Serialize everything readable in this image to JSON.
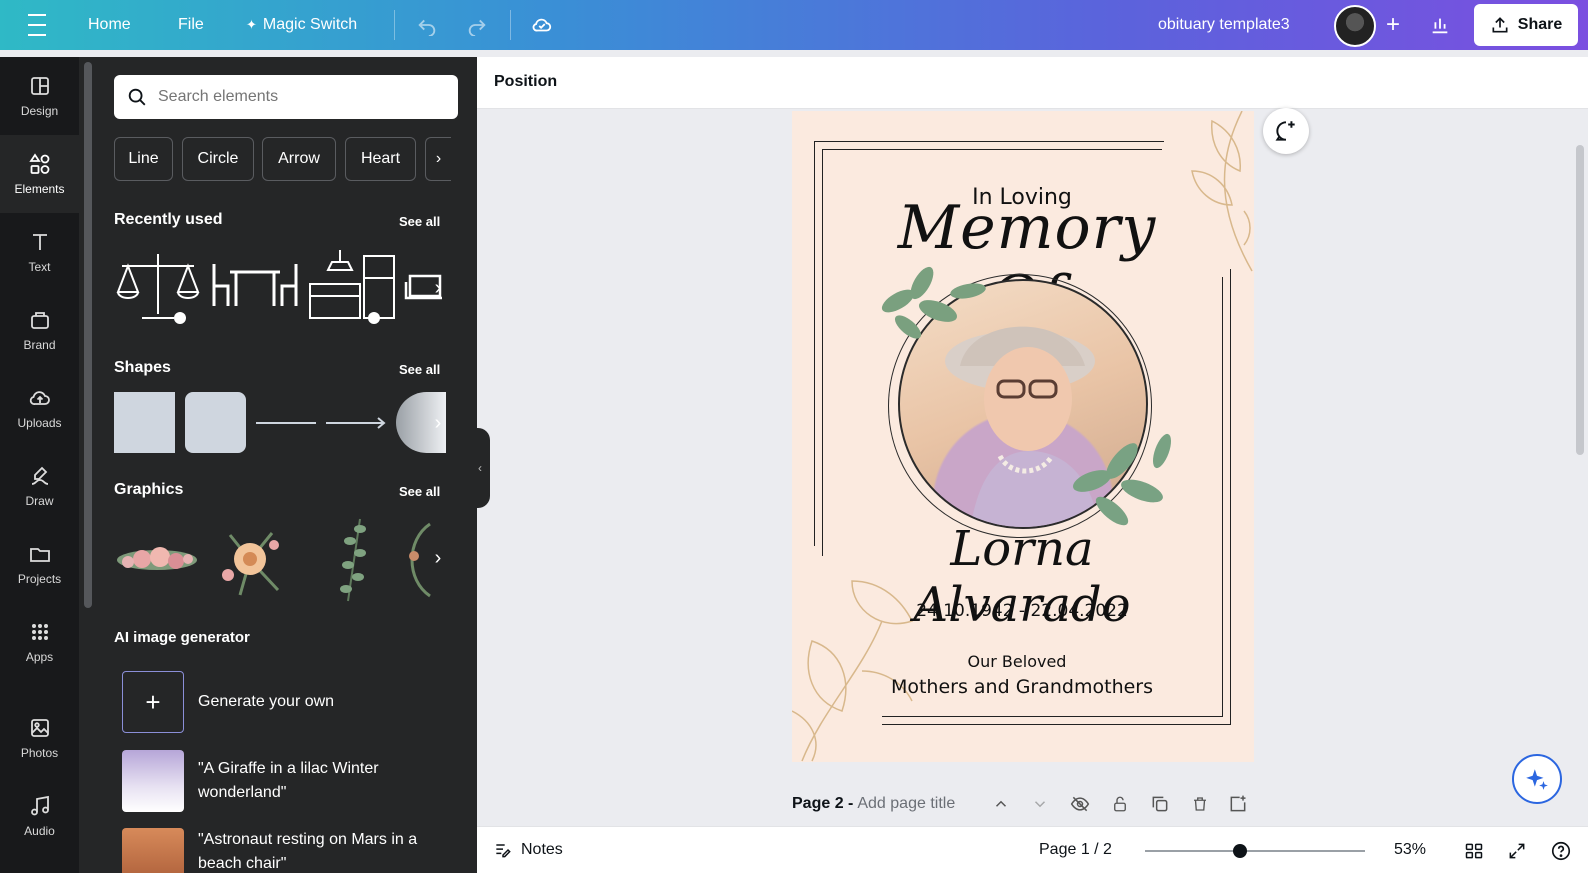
{
  "topbar": {
    "home": "Home",
    "file": "File",
    "magic_switch": "Magic Switch",
    "doc_title": "obituary template3",
    "share": "Share"
  },
  "rail": [
    {
      "label": "Design",
      "icon": "layout-icon"
    },
    {
      "label": "Elements",
      "icon": "shapes-icon"
    },
    {
      "label": "Text",
      "icon": "text-icon"
    },
    {
      "label": "Brand",
      "icon": "brand-icon"
    },
    {
      "label": "Uploads",
      "icon": "cloud-upload-icon"
    },
    {
      "label": "Draw",
      "icon": "pen-icon"
    },
    {
      "label": "Projects",
      "icon": "folder-icon"
    },
    {
      "label": "Apps",
      "icon": "grid-icon"
    },
    {
      "label": "Photos",
      "icon": "image-icon"
    },
    {
      "label": "Audio",
      "icon": "music-icon"
    }
  ],
  "panel": {
    "search_placeholder": "Search elements",
    "chips": [
      "Line",
      "Circle",
      "Arrow",
      "Heart"
    ],
    "recently_used": "Recently used",
    "shapes": "Shapes",
    "graphics": "Graphics",
    "see_all": "See all",
    "ai_title": "AI image generator",
    "generate": "Generate your own",
    "suggestions": [
      "\"A Giraffe in a lilac Winter wonderland\"",
      "\"Astronaut resting on Mars in a beach chair\""
    ]
  },
  "canvas": {
    "toolbar_label": "Position",
    "page": {
      "in_loving": "In Loving",
      "memory_of": "Memory Of",
      "name": "Lorna Alvarado",
      "dates": "24.10.1942 - 22.04.2022",
      "beloved": "Our Beloved",
      "relation": "Mothers and Grandmothers"
    },
    "page_label": "Page 2 -",
    "page_title_placeholder": "Add page title"
  },
  "bottombar": {
    "notes": "Notes",
    "page_count": "Page 1 / 2",
    "zoom": "53%"
  },
  "colors": {
    "page_bg": "#fbeadf",
    "panel_bg": "#252627",
    "rail_bg": "#18191b",
    "accent": "#7b4fe0"
  }
}
